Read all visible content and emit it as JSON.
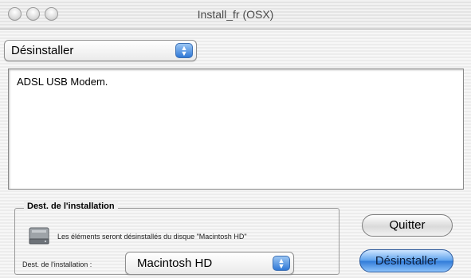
{
  "window": {
    "title": "Install_fr (OSX)"
  },
  "action_menu": {
    "selected": "Désinstaller"
  },
  "package_list": {
    "items": [
      "ADSL USB Modem."
    ]
  },
  "destination": {
    "group_title": "Dest. de l'installation",
    "info_text": "Les éléments seront désinstallés du disque \"Macintosh HD\"",
    "field_label": "Dest. de l'installation :",
    "selected_volume": "Macintosh HD"
  },
  "buttons": {
    "quit_label": "Quitter",
    "uninstall_label": "Désinstaller"
  },
  "colors": {
    "accent": "#2f7ad8",
    "window_background": "#efefef"
  },
  "icons": [
    "close-icon",
    "minimize-icon",
    "zoom-icon",
    "popup-arrow-icon",
    "hard-disk-icon"
  ]
}
